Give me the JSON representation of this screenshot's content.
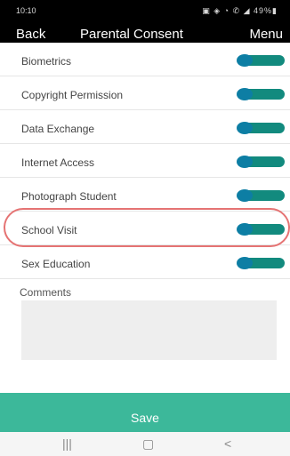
{
  "status_bar": {
    "time": "10:10",
    "icons": "▣ ◈ ◔ ✆ ◢ 49%▮"
  },
  "nav": {
    "back_label": "Back",
    "title": "Parental Consent",
    "menu_label": "Menu"
  },
  "consents": [
    {
      "label": "Biometrics",
      "enabled": true
    },
    {
      "label": "Copyright Permission",
      "enabled": true
    },
    {
      "label": "Data Exchange",
      "enabled": true
    },
    {
      "label": "Internet Access",
      "enabled": true
    },
    {
      "label": "Photograph Student",
      "enabled": true
    },
    {
      "label": "School Visit",
      "enabled": true
    },
    {
      "label": "Sex Education",
      "enabled": true
    }
  ],
  "comments": {
    "label": "Comments",
    "value": ""
  },
  "save_label": "Save",
  "android_nav": {
    "recent": "|||",
    "home": "▢",
    "back": "<"
  },
  "colors": {
    "toggle_track": "#128a7e",
    "toggle_knob": "#0d7ea4",
    "save_bar": "#3cb89a",
    "highlight": "#e57373"
  }
}
